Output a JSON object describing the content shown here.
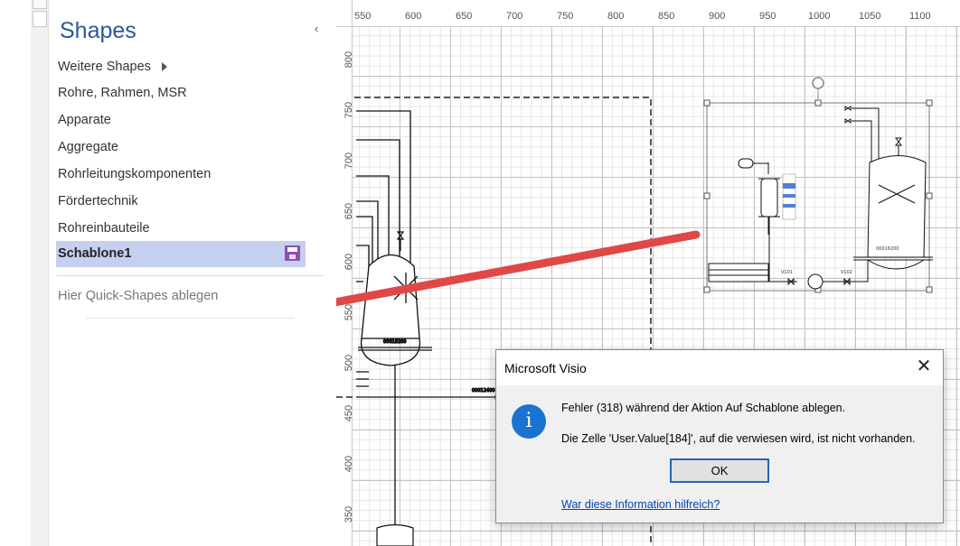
{
  "shapes_panel": {
    "title": "Shapes",
    "collapse_glyph": "‹",
    "items": [
      {
        "label": "Weitere Shapes"
      },
      {
        "label": "Rohre, Rahmen, MSR"
      },
      {
        "label": "Apparate"
      },
      {
        "label": "Aggregate"
      },
      {
        "label": "Rohrleitungskomponenten"
      },
      {
        "label": "Fördertechnik"
      },
      {
        "label": "Rohreinbauteile"
      },
      {
        "label": "Schablone1"
      }
    ],
    "selected_item": "Schablone1",
    "quick_shapes_hint": "Hier Quick-Shapes ablegen"
  },
  "ruler": {
    "horizontal": [
      "550",
      "600",
      "650",
      "700",
      "750",
      "800",
      "850",
      "900",
      "950",
      "1000",
      "1050",
      "1100"
    ],
    "vertical": [
      "800",
      "750",
      "700",
      "650",
      "600",
      "550",
      "500",
      "450",
      "400",
      "350"
    ]
  },
  "dialog": {
    "title": "Microsoft Visio",
    "close_glyph": "✕",
    "icon_glyph": "i",
    "message_line1": "Fehler (318) während der Aktion Auf Schablone ablegen.",
    "message_line2": "Die Zelle 'User.Value[184]', auf die verwiesen wird, ist nicht vorhanden.",
    "ok_label": "OK",
    "help_link": "War diese Information hilfreich?"
  },
  "colors": {
    "accent": "#2b579a",
    "selected_bg": "#c5cff0",
    "arrow": "#e04848",
    "info_icon": "#1a73d1",
    "link": "#0645ad"
  }
}
